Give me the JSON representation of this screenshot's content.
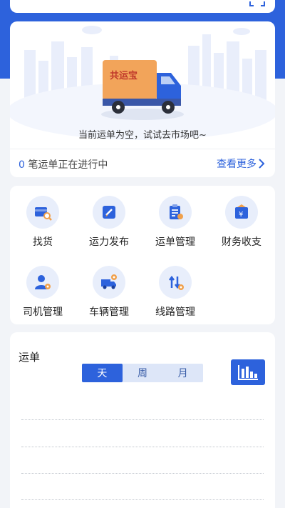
{
  "colors": {
    "primary": "#2d62dc",
    "background": "#f2f4f8"
  },
  "hero": {
    "truck_brand": "共运宝",
    "empty_text": "当前运单为空，试试去市场吧~",
    "ongoing_count": "0",
    "ongoing_text": "笔运单正在进行中",
    "more_label": "查看更多"
  },
  "menu": {
    "items": [
      {
        "label": "找货",
        "icon": "find-goods-icon"
      },
      {
        "label": "运力发布",
        "icon": "publish-capacity-icon"
      },
      {
        "label": "运单管理",
        "icon": "waybill-manage-icon"
      },
      {
        "label": "财务收支",
        "icon": "finance-icon"
      },
      {
        "label": "司机管理",
        "icon": "driver-manage-icon"
      },
      {
        "label": "车辆管理",
        "icon": "vehicle-manage-icon"
      },
      {
        "label": "线路管理",
        "icon": "route-manage-icon"
      }
    ]
  },
  "orders": {
    "title": "运单",
    "tabs": [
      "天",
      "周",
      "月"
    ],
    "active_tab": "天",
    "chart_icon": "bar-chart-icon"
  }
}
